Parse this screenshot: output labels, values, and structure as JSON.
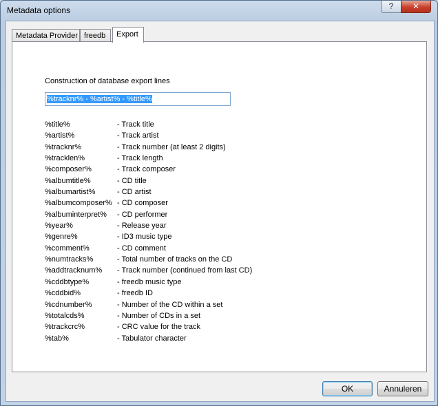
{
  "window": {
    "title": "Metadata options"
  },
  "titlebar": {
    "help_glyph": "?",
    "close_glyph": "✕"
  },
  "tabs": [
    {
      "label": "Metadata Provider",
      "active": false
    },
    {
      "label": "freedb",
      "active": false
    },
    {
      "label": "Export",
      "active": true
    }
  ],
  "export": {
    "heading": "Construction of database export lines",
    "pattern_value": "%tracknr% - %artist% - %title%",
    "variables": [
      {
        "name": "%title%",
        "desc": "- Track title"
      },
      {
        "name": "%artist%",
        "desc": "- Track artist"
      },
      {
        "name": "%tracknr%",
        "desc": "- Track number (at least 2 digits)"
      },
      {
        "name": "%tracklen%",
        "desc": "- Track length"
      },
      {
        "name": "%composer%",
        "desc": "- Track composer"
      },
      {
        "name": "%albumtitle%",
        "desc": "- CD title"
      },
      {
        "name": "%albumartist%",
        "desc": "- CD artist"
      },
      {
        "name": "%albumcomposer%",
        "desc": "- CD composer"
      },
      {
        "name": "%albuminterpret%",
        "desc": "- CD performer"
      },
      {
        "name": "%year%",
        "desc": "- Release year"
      },
      {
        "name": "%genre%",
        "desc": "- ID3 music type"
      },
      {
        "name": "%comment%",
        "desc": "- CD comment"
      },
      {
        "name": "%numtracks%",
        "desc": "- Total number of tracks on the CD"
      },
      {
        "name": "%addtracknum%",
        "desc": "- Track number (continued from last CD)"
      },
      {
        "name": "%cddbtype%",
        "desc": "- freedb music type"
      },
      {
        "name": "%cddbid%",
        "desc": "- freedb ID"
      },
      {
        "name": "%cdnumber%",
        "desc": "- Number of the CD within a set"
      },
      {
        "name": "%totalcds%",
        "desc": "- Number of CDs in a set"
      },
      {
        "name": "%trackcrc%",
        "desc": "- CRC value for the track"
      },
      {
        "name": "%tab%",
        "desc": "- Tabulator character"
      }
    ]
  },
  "buttons": {
    "ok": "OK",
    "cancel": "Annuleren"
  }
}
